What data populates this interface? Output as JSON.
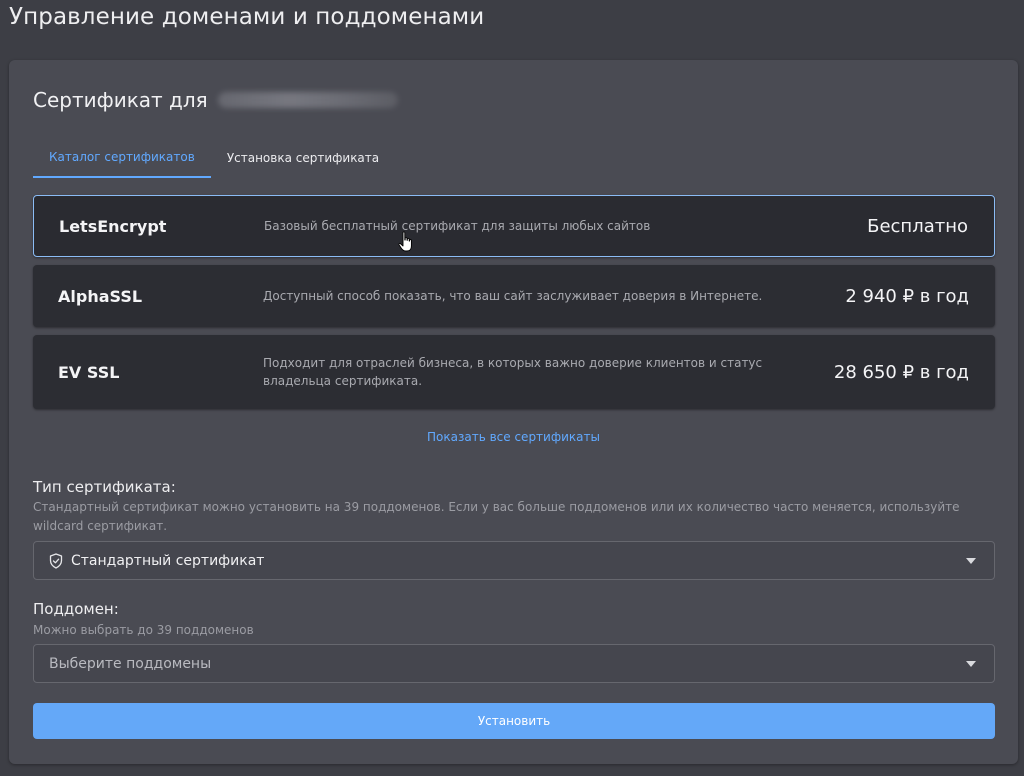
{
  "page": {
    "title": "Управление доменами и поддоменами"
  },
  "card": {
    "title_prefix": "Сертификат для"
  },
  "tabs": [
    {
      "label": "Каталог сертификатов",
      "active": true
    },
    {
      "label": "Установка сертификата",
      "active": false
    }
  ],
  "certificates": [
    {
      "name": "LetsEncrypt",
      "description": "Базовый бесплатный сертификат для защиты любых сайтов",
      "price": "Бесплатно",
      "selected": true
    },
    {
      "name": "AlphaSSL",
      "description": "Доступный способ показать, что ваш сайт заслуживает доверия в Интернете.",
      "price": "2 940 ₽ в год",
      "selected": false
    },
    {
      "name": "EV SSL",
      "description": "Подходит для отраслей бизнеса, в которых важно доверие клиентов и статус владельца сертификата.",
      "price": "28 650 ₽ в год",
      "selected": false
    }
  ],
  "show_all_link": "Показать все сертификаты",
  "cert_type": {
    "label": "Тип сертификата:",
    "hint": "Стандартный сертификат можно установить на 39 поддоменов. Если у вас больше поддоменов или их количество часто меняется, используйте wildcard сертификат.",
    "selected_value": "Стандартный сертификат",
    "icon": "shield-check-icon"
  },
  "subdomain": {
    "label": "Поддомен:",
    "hint": "Можно выбрать до 39 поддоменов",
    "placeholder": "Выберите поддомены"
  },
  "submit_label": "Установить",
  "colors": {
    "accent": "#64a8f8",
    "link": "#61a9ff",
    "background": "#3d3e45",
    "card": "#4a4b53",
    "item": "#2c2d33"
  }
}
